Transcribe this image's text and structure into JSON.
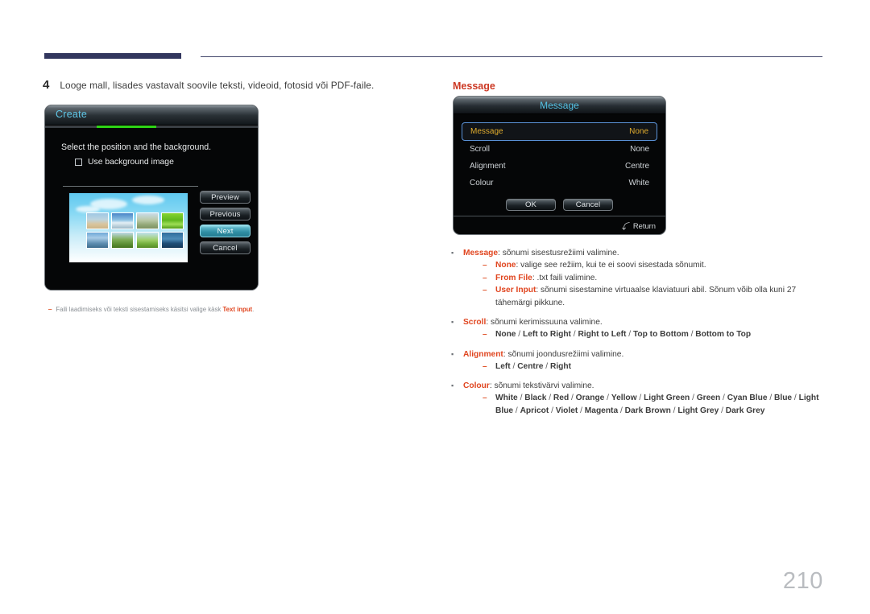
{
  "header": {
    "rule": "decorative-header-rule"
  },
  "step": {
    "number": "4",
    "text": "Looge mall, lisades vastavalt soovile teksti, videoid, fotosid või PDF-faile."
  },
  "create_dialog": {
    "title": "Create",
    "instruction": "Select the position and the background.",
    "checkbox_label": "Use background image",
    "checkbox_checked": false,
    "buttons": [
      {
        "label": "Preview",
        "selected": false
      },
      {
        "label": "Previous",
        "selected": false
      },
      {
        "label": "Next",
        "selected": true
      },
      {
        "label": "Cancel",
        "selected": false
      }
    ],
    "progress_color": "#2fd416",
    "title_color": "#5fc7e8",
    "selected_button_color": "#2f8ea4"
  },
  "footnote": {
    "dash": "‒",
    "text_before": "Faili laadimiseks või teksti sisestamiseks käsitsi valige käsk",
    "highlight": "Text input",
    "text_after": "."
  },
  "section": {
    "title": "Message",
    "title_color": "#cc3924"
  },
  "message_dialog": {
    "title": "Message",
    "title_color": "#54c3e6",
    "rows": [
      {
        "label": "Message",
        "value": "None",
        "selected": true
      },
      {
        "label": "Scroll",
        "value": "None",
        "selected": false
      },
      {
        "label": "Alignment",
        "value": "Centre",
        "selected": false
      },
      {
        "label": "Colour",
        "value": "White",
        "selected": false
      }
    ],
    "ok_label": "OK",
    "cancel_label": "Cancel",
    "return_label": "Return",
    "return_icon": "return-arrow-icon",
    "selected_row_border_color": "#5b93d8",
    "selected_row_text_color": "#e0ac2e"
  },
  "bullets": [
    {
      "keyword": "Message",
      "rest": ": sõnumi sisestusrežiimi valimine.",
      "sub": [
        {
          "keyword": "None",
          "rest": ": valige see režiim, kui te ei soovi sisestada sõnumit."
        },
        {
          "keyword": "From File",
          "rest": ": .txt faili valimine."
        },
        {
          "keyword": "User Input",
          "rest": ": sõnumi sisestamine virtuaalse klaviatuuri abil. Sõnum võib olla kuni 27 tähemärgi pikkune."
        }
      ]
    },
    {
      "keyword": "Scroll",
      "rest": ": sõnumi kerimissuuna valimine.",
      "options": [
        "None",
        "Left to Right",
        "Right to Left",
        "Top to Bottom",
        "Bottom to Top"
      ]
    },
    {
      "keyword": "Alignment",
      "rest": ": sõnumi joondusrežiimi valimine.",
      "options": [
        "Left",
        "Centre",
        "Right"
      ]
    },
    {
      "keyword": "Colour",
      "rest": ": sõnumi tekstivärvi valimine.",
      "options": [
        "White",
        "Black",
        "Red",
        "Orange",
        "Yellow",
        "Light Green",
        "Green",
        "Cyan Blue",
        "Blue",
        "Light Blue",
        "Apricot",
        "Violet",
        "Magenta",
        "Dark Brown",
        "Light Grey",
        "Dark Grey"
      ]
    }
  ],
  "page_number": "210"
}
